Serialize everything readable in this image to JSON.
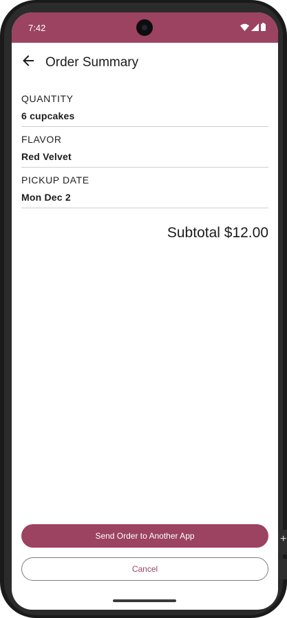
{
  "status_bar": {
    "time": "7:42"
  },
  "app_bar": {
    "title": "Order Summary",
    "back_icon": "arrow-back-icon"
  },
  "summary": {
    "items": [
      {
        "label": "QUANTITY",
        "value": "6 cupcakes"
      },
      {
        "label": "FLAVOR",
        "value": "Red Velvet"
      },
      {
        "label": "PICKUP DATE",
        "value": "Mon Dec 2"
      }
    ],
    "subtotal": "Subtotal $12.00"
  },
  "actions": {
    "send_label": "Send Order to Another App",
    "cancel_label": "Cancel"
  },
  "colors": {
    "accent": "#9b4360",
    "divider": "#cfcfcf"
  }
}
